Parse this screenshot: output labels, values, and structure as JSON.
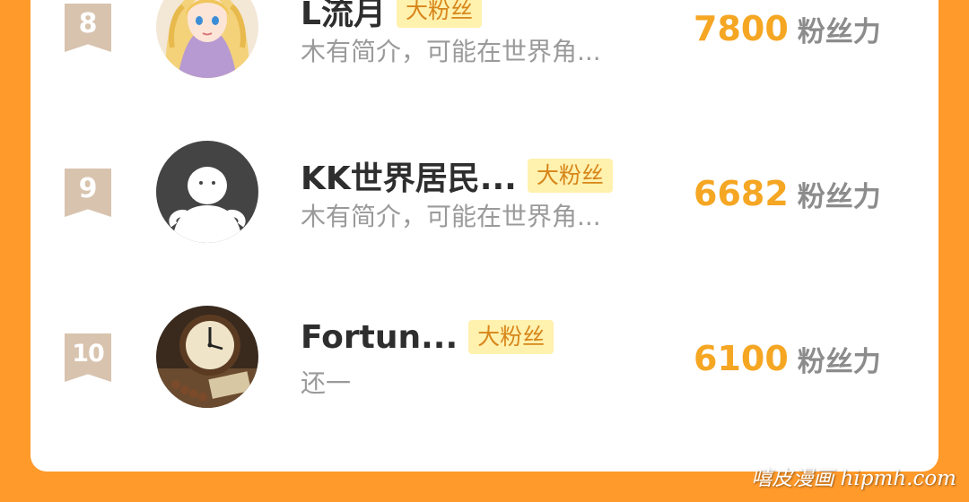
{
  "ranking": [
    {
      "rank": "8",
      "name": "L流月",
      "badge": "大粉丝",
      "intro": "木有简介，可能在世界角...",
      "score": "7800",
      "score_unit": "粉丝力",
      "avatar": "anime-girl-avatar"
    },
    {
      "rank": "9",
      "name": "KK世界居民...",
      "badge": "大粉丝",
      "intro": "木有简介，可能在世界角...",
      "score": "6682",
      "score_unit": "粉丝力",
      "avatar": "default-avatar"
    },
    {
      "rank": "10",
      "name": "Fortun...",
      "badge": "大粉丝",
      "intro": "还一",
      "score": "6100",
      "score_unit": "粉丝力",
      "avatar": "clock-photo-avatar"
    }
  ],
  "watermark": "嘻皮漫画 hipmh.com",
  "colors": {
    "background": "#FF9A2B",
    "card": "#FFFFFF",
    "score": "#F5A623",
    "badge_bg": "#FFF1AE",
    "badge_text": "#D7861A",
    "rank_ribbon": "#D8C3AE"
  }
}
